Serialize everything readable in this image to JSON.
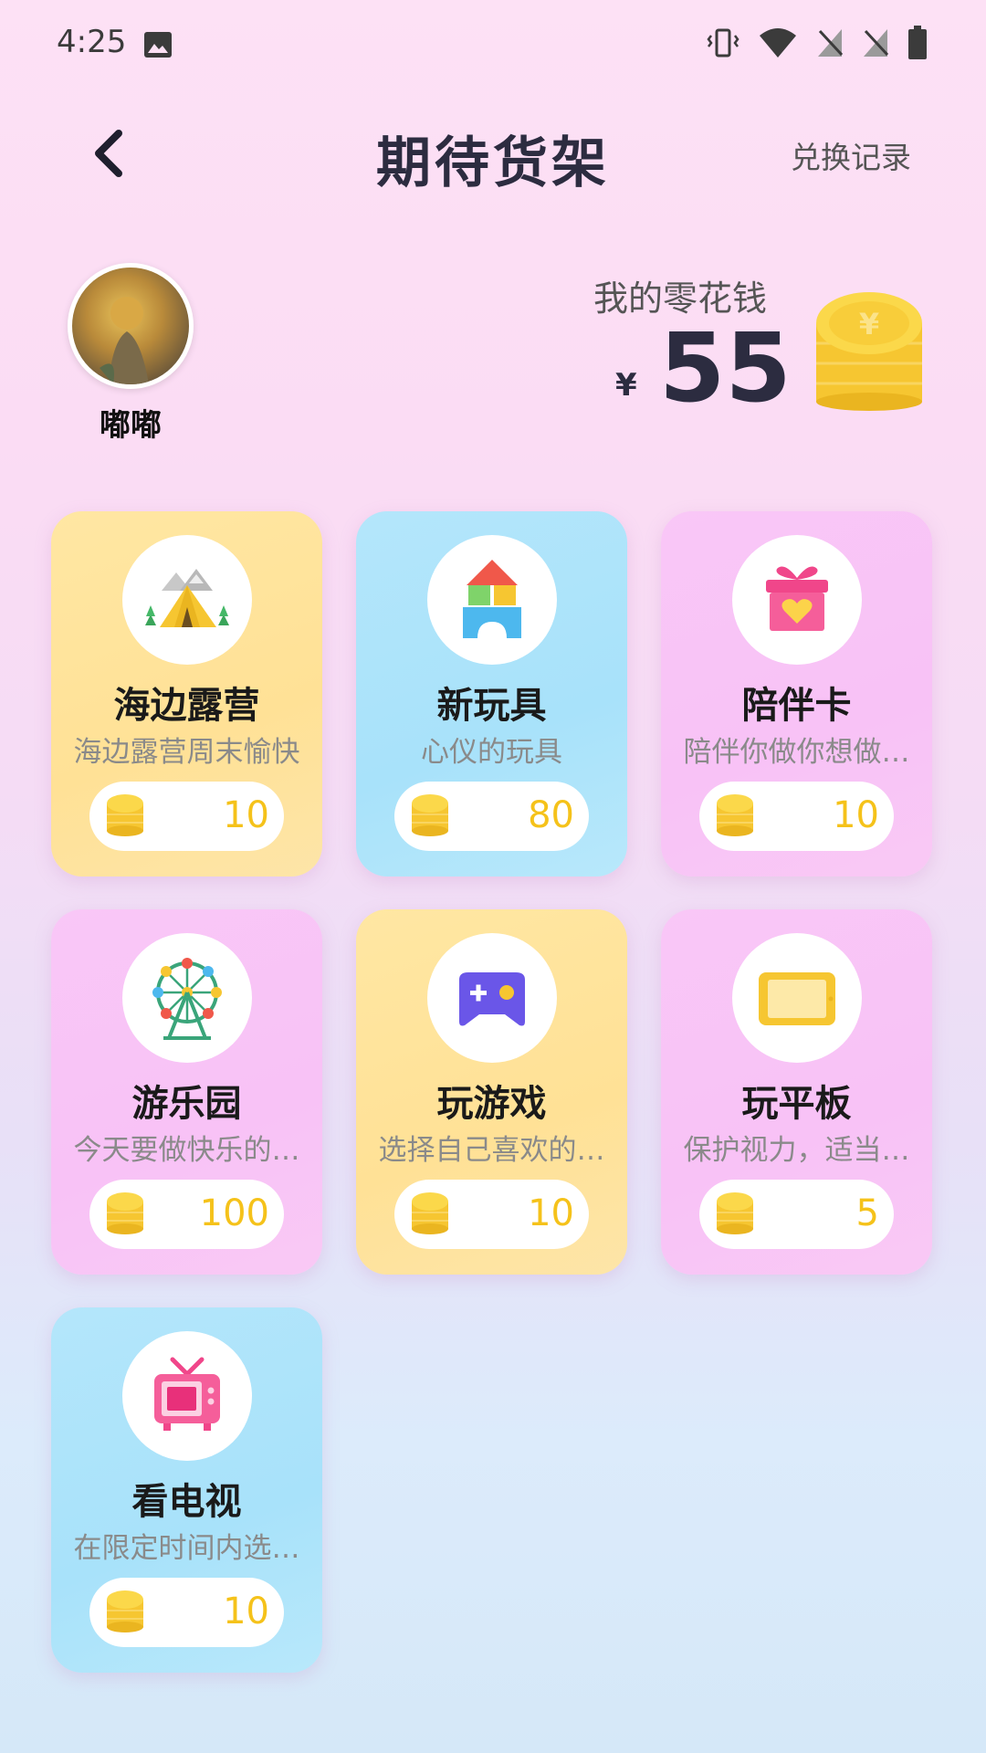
{
  "status_bar": {
    "time": "4:25"
  },
  "header": {
    "title": "期待货架",
    "history_label": "兑换记录"
  },
  "profile": {
    "name": "嘟嘟"
  },
  "wallet": {
    "label": "我的零花钱",
    "currency_symbol": "¥",
    "amount": "55"
  },
  "colors": {
    "coin": "#f5c21a",
    "card_yellow": "#ffe196",
    "card_blue": "#a8e2fa",
    "card_pink": "#f8c2f6",
    "title_dark": "#2c2c40"
  },
  "items": [
    {
      "title": "海边露营",
      "desc": "海边露营周末愉快",
      "price": "10",
      "icon": "camping-tent-icon",
      "color": "yellow"
    },
    {
      "title": "新玩具",
      "desc": "心仪的玩具",
      "price": "80",
      "icon": "toy-blocks-icon",
      "color": "blue"
    },
    {
      "title": "陪伴卡",
      "desc": "陪伴你做你想做…",
      "price": "10",
      "icon": "gift-heart-icon",
      "color": "pink"
    },
    {
      "title": "游乐园",
      "desc": "今天要做快乐的…",
      "price": "100",
      "icon": "ferris-wheel-icon",
      "color": "pink"
    },
    {
      "title": "玩游戏",
      "desc": "选择自己喜欢的…",
      "price": "10",
      "icon": "gamepad-icon",
      "color": "yellow"
    },
    {
      "title": "玩平板",
      "desc": "保护视力，适当…",
      "price": "5",
      "icon": "tablet-icon",
      "color": "pink"
    },
    {
      "title": "看电视",
      "desc": "在限定时间内选…",
      "price": "10",
      "icon": "tv-icon",
      "color": "blue"
    }
  ]
}
